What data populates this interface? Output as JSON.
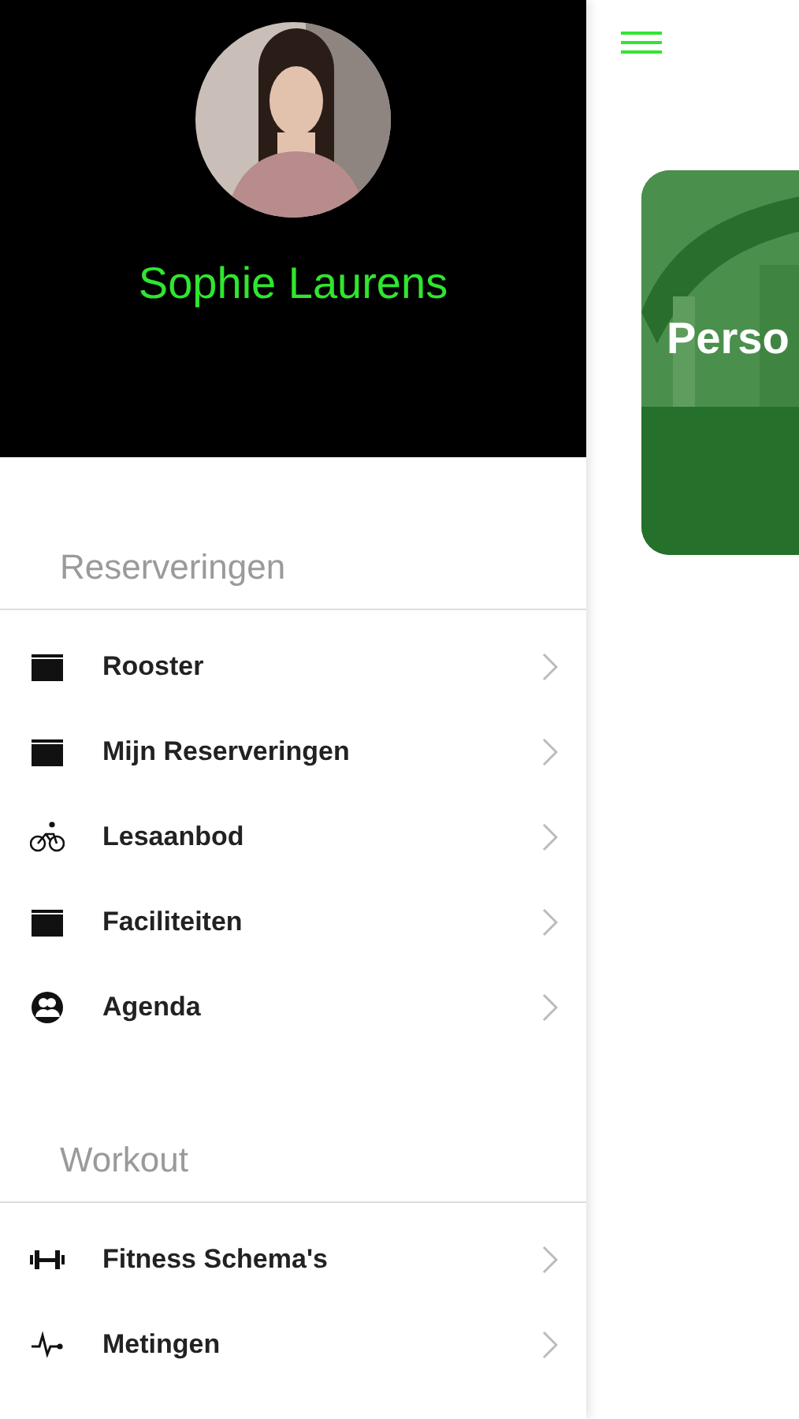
{
  "profile": {
    "name": "Sophie Laurens"
  },
  "sections": [
    {
      "title": "Reserveringen",
      "items": [
        {
          "label": "Rooster"
        },
        {
          "label": "Mijn Reserveringen"
        },
        {
          "label": "Lesaanbod"
        },
        {
          "label": "Faciliteiten"
        },
        {
          "label": "Agenda"
        }
      ]
    },
    {
      "title": "Workout",
      "items": [
        {
          "label": "Fitness Schema's"
        },
        {
          "label": "Metingen"
        }
      ]
    }
  ],
  "card": {
    "title": "Perso"
  }
}
